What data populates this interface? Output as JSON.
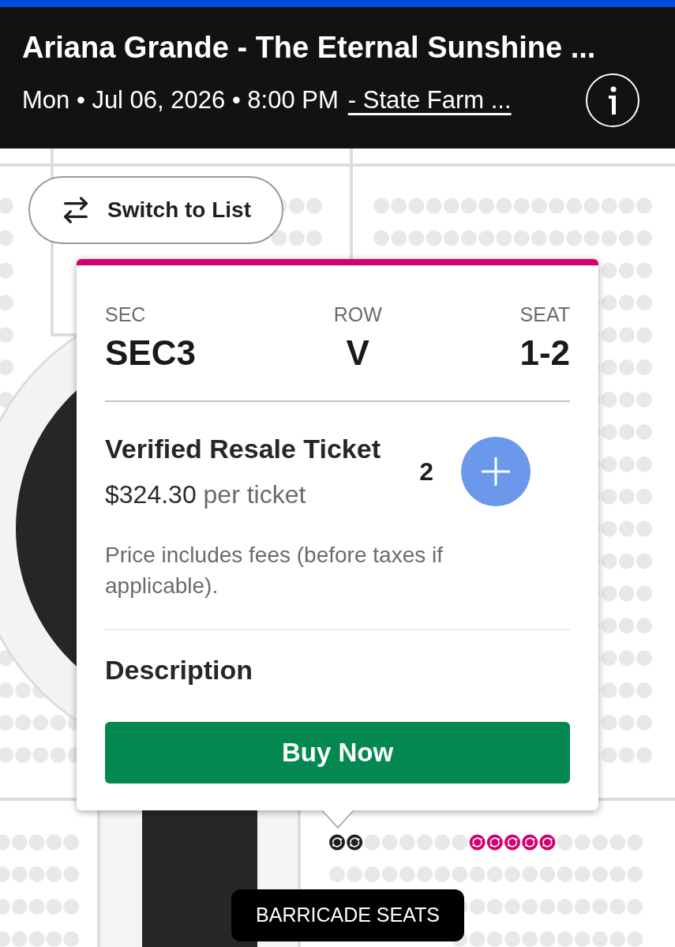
{
  "header": {
    "title": "Ariana Grande - The Eternal Sunshine ...",
    "date_time": "Mon • Jul 06, 2026 • 8:00 PM",
    "venue_link": "- State Farm ..."
  },
  "map": {
    "switch_button": "Switch to List",
    "seats": [
      {
        "color": "#1f1f1f"
      },
      {
        "color": "#1f1f1f"
      },
      {
        "color": "#d6006d"
      },
      {
        "color": "#d6006d"
      },
      {
        "color": "#d6006d"
      },
      {
        "color": "#d6006d"
      },
      {
        "color": "#d6006d"
      }
    ],
    "section_label": "BARRICADE SEATS"
  },
  "ticket_card": {
    "fields": [
      {
        "label": "SEC",
        "value": "SEC3"
      },
      {
        "label": "ROW",
        "value": "V"
      },
      {
        "label": "SEAT",
        "value": "1-2"
      }
    ],
    "ticket_type": "Verified Resale Ticket",
    "price": "$324.30",
    "price_unit": "per ticket",
    "quantity": "2",
    "fee_note": "Price includes fees (before taxes if applicable).",
    "description_heading": "Description",
    "buy_button": "Buy Now"
  }
}
